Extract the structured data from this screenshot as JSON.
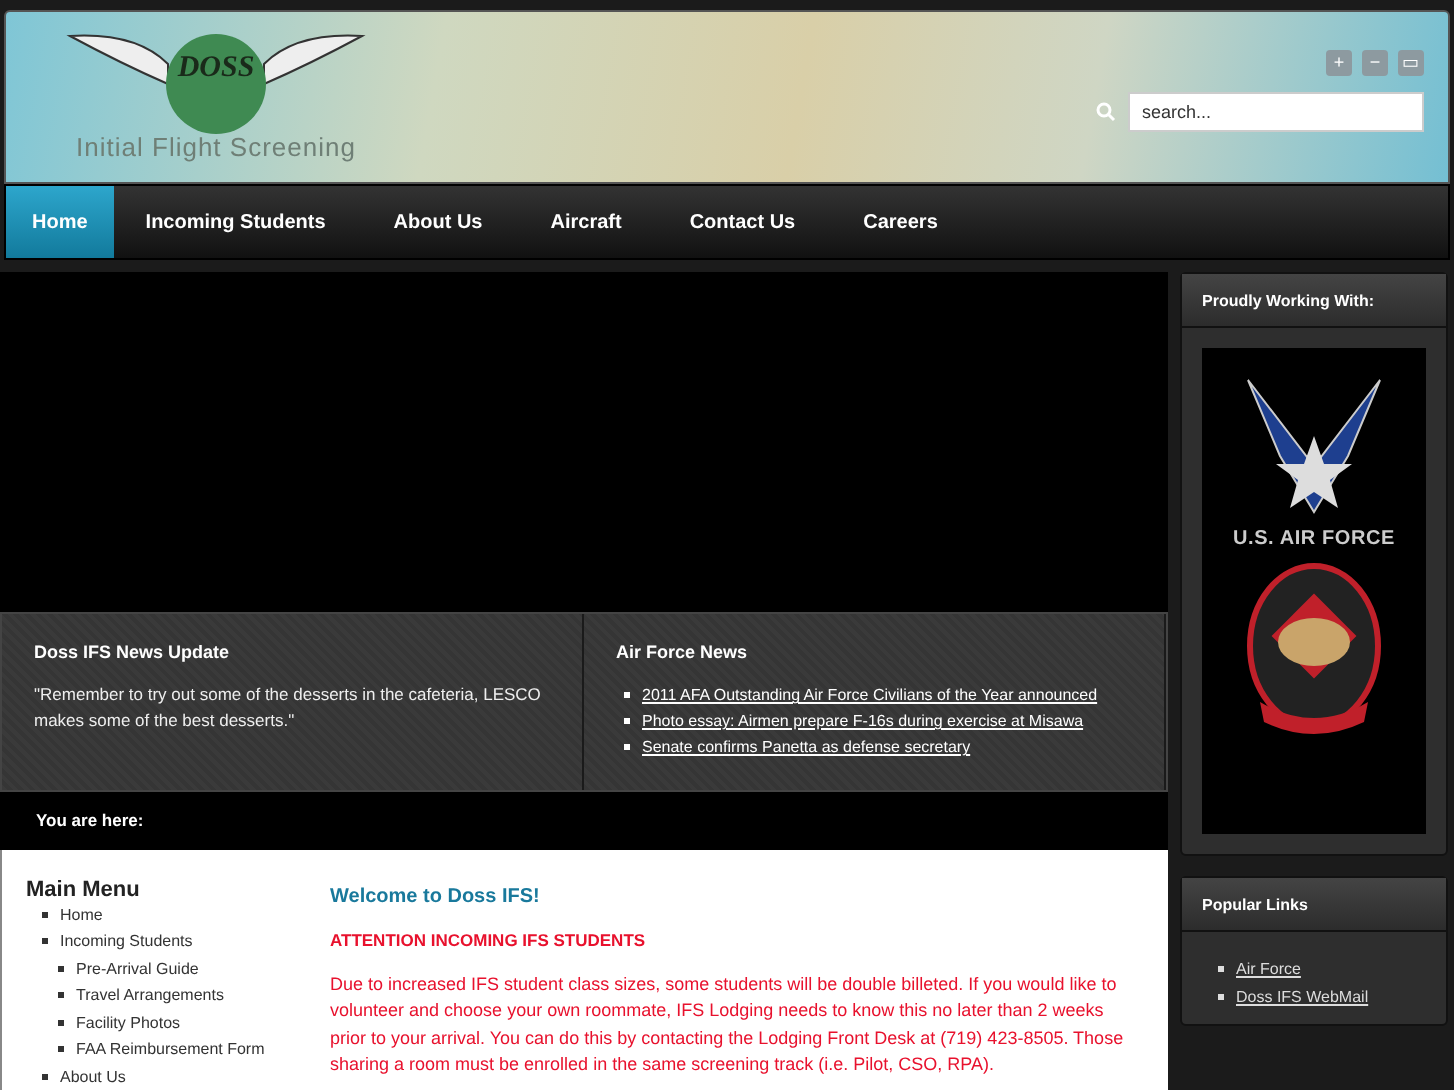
{
  "header": {
    "logo_text": "DOSS",
    "tagline": "Initial Flight Screening",
    "window_buttons": [
      "+",
      "−",
      "▭"
    ],
    "search": {
      "placeholder": "search..."
    }
  },
  "nav": [
    {
      "label": "Home",
      "selected": true
    },
    {
      "label": "Incoming Students",
      "selected": false
    },
    {
      "label": "About Us",
      "selected": false
    },
    {
      "label": "Aircraft",
      "selected": false
    },
    {
      "label": "Contact Us",
      "selected": false
    },
    {
      "label": "Careers",
      "selected": false
    }
  ],
  "news_panels": [
    {
      "title": "Doss IFS News Update",
      "kind": "text",
      "text": "\"Remember to try out some of the desserts in the cafeteria, LESCO makes some of the best desserts.\""
    },
    {
      "title": "Air Force News",
      "kind": "links",
      "links": [
        "2011 AFA Outstanding Air Force Civilians of the Year announced",
        "Photo essay: Airmen prepare F-16s during exercise at Misawa",
        "Senate confirms Panetta as defense secretary"
      ]
    }
  ],
  "breadcrumb": "You are here:",
  "main_menu": {
    "title": "Main Menu",
    "items": [
      {
        "label": "Home"
      },
      {
        "label": "Incoming Students",
        "children": [
          {
            "label": "Pre-Arrival Guide"
          },
          {
            "label": "Travel Arrangements"
          },
          {
            "label": "Facility Photos"
          },
          {
            "label": "FAA Reimbursement Form"
          }
        ]
      },
      {
        "label": "About Us"
      }
    ]
  },
  "article": {
    "title": "Welcome to Doss IFS!",
    "attention": "ATTENTION INCOMING IFS STUDENTS",
    "body": "Due to increased IFS student class sizes, some students will be double billeted.  If you would like to volunteer and choose your own roommate, IFS Lodging needs to know this no later than 2 weeks prior to your arrival.  You can do this by contacting the Lodging Front Desk at (719) 423-8505.  Those sharing a room must be enrolled in the same screening track (i.e. Pilot, CSO, RPA)."
  },
  "sidebar": [
    {
      "title": "Proudly Working With:",
      "kind": "logos",
      "logo_caption": "U.S. AIR FORCE"
    },
    {
      "title": "Popular Links",
      "kind": "links",
      "links": [
        "Air Force",
        "Doss IFS WebMail"
      ]
    }
  ]
}
